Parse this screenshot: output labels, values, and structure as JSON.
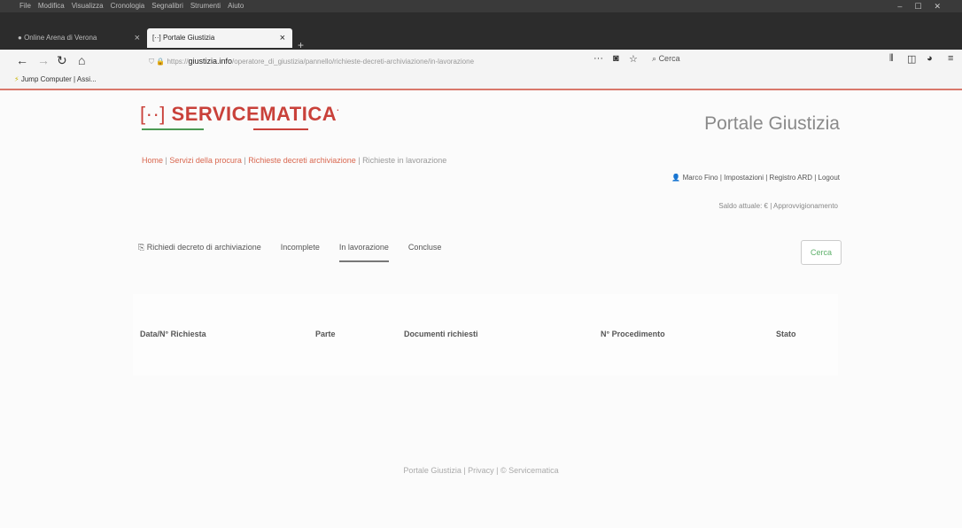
{
  "browser": {
    "menu": [
      "File",
      "Modifica",
      "Visualizza",
      "Cronologia",
      "Segnalibri",
      "Strumenti",
      "Aiuto"
    ],
    "tabs": [
      {
        "label": "Online Arena di Verona"
      },
      {
        "label": "Portale Giustizia"
      }
    ],
    "url_prefix": "https://",
    "url_domain": "giustizia.info",
    "url_path": "/operatore_di_giustizia/pannello/richieste-decreti-archiviazione/in-lavorazione",
    "search_placeholder": "Cerca",
    "bookmark": "Jump Computer | Assi..."
  },
  "page": {
    "brand": "SERVICEMATICA",
    "portal_title": "Portale Giustizia",
    "breadcrumb": {
      "home": "Home",
      "sep1": " | ",
      "servizi": "Servizi della procura",
      "sep2": " | ",
      "richieste": "Richieste decreti archiviazione",
      "sep3": " | ",
      "current": "Richieste in lavorazione"
    },
    "user_menu": "Marco Fino | Impostazioni | Registro ARD | Logout",
    "balance": "Saldo attuale: € | Approvvigionamento",
    "tabs": [
      "Richiedi decreto di archiviazione",
      "Incomplete",
      "In lavorazione",
      "Concluse"
    ],
    "search_button": "Cerca",
    "table_headers": [
      "Data/N° Richiesta",
      "Parte",
      "Documenti richiesti",
      "N° Procedimento",
      "Stato"
    ],
    "footer": "Portale Giustizia | Privacy | © Servicematica"
  }
}
